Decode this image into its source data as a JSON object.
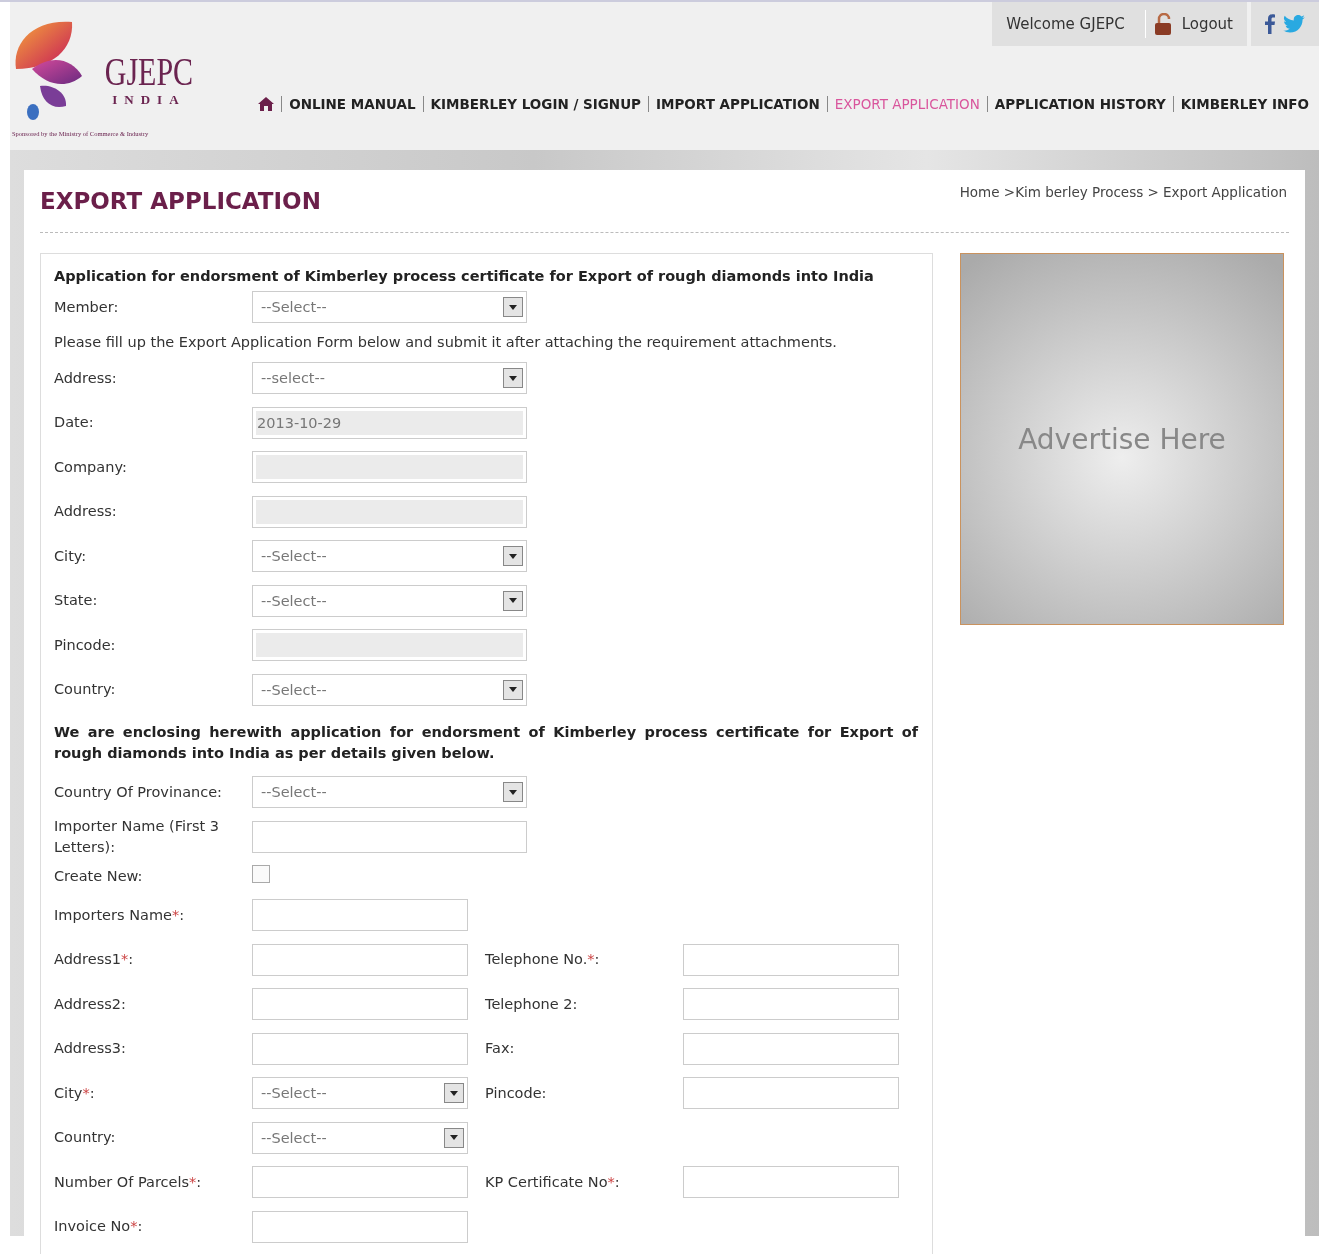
{
  "logo": {
    "name": "GJEPC",
    "country": "INDIA",
    "tagline": "Sponsored by the Ministry of Commerce & Industry"
  },
  "top_bar": {
    "welcome": "Welcome GJEPC",
    "logout": "Logout"
  },
  "nav": [
    {
      "label": "ONLINE MANUAL",
      "selected": false
    },
    {
      "label": "KIMBERLEY LOGIN / SIGNUP",
      "selected": false
    },
    {
      "label": "IMPORT APPLICATION",
      "selected": false
    },
    {
      "label": "EXPORT APPLICATION",
      "selected": true
    },
    {
      "label": "APPLICATION HISTORY",
      "selected": false
    },
    {
      "label": "KIMBERLEY INFO",
      "selected": false
    }
  ],
  "page_title": "EXPORT APPLICATION",
  "breadcrumb": "Home >Kim berley Process > Export Application",
  "form": {
    "heading": "Application for endorsment of Kimberley process certificate for Export of rough diamonds into India",
    "member": {
      "label": "Member:",
      "kind": "select",
      "value": "--Select--"
    },
    "instruction": "Please fill up the Export Application Form below and submit it after attaching the requirement attachments.",
    "fields": [
      {
        "label": "Address:",
        "kind": "select",
        "value": "--select--"
      },
      {
        "label": "Date:",
        "kind": "disabled",
        "value": "2013-10-29"
      },
      {
        "label": "Company:",
        "kind": "disabled"
      },
      {
        "label": "Address:",
        "kind": "disabled"
      },
      {
        "label": "City:",
        "kind": "select",
        "value": "--Select--"
      },
      {
        "label": "State:",
        "kind": "select",
        "value": "--Select--"
      },
      {
        "label": "Pincode:",
        "kind": "disabled"
      },
      {
        "label": "Country:",
        "kind": "select",
        "value": "--Select--"
      }
    ],
    "enclosing_note": "We are enclosing herewith application for endorsment of Kimberley process certificate for Export of rough diamonds into India as per details given below.",
    "importer_fields": [
      {
        "label": "Country Of Provinance:",
        "kind": "select",
        "value": "--Select--"
      },
      {
        "label": "Importer Name (First 3 Letters):",
        "kind": "text"
      },
      {
        "label": "Create New:",
        "kind": "checkbox",
        "checked": false
      }
    ],
    "detail_rows": [
      {
        "left": {
          "label": "Importers Name",
          "required_mark": "*",
          "label_end": ":",
          "kind": "text"
        }
      },
      {
        "left": {
          "label": "Address1",
          "required_mark": "*",
          "label_end": ":",
          "kind": "text"
        },
        "right": {
          "label": "Telephone No.",
          "required_mark": "*",
          "label_end": ":",
          "kind": "text"
        }
      },
      {
        "left": {
          "label": "Address2:",
          "kind": "text"
        },
        "right": {
          "label": "Telephone 2:",
          "kind": "text"
        }
      },
      {
        "left": {
          "label": "Address3:",
          "kind": "text"
        },
        "right": {
          "label": "Fax:",
          "kind": "text"
        }
      },
      {
        "left": {
          "label": "City",
          "required_mark": "*",
          "label_end": ":",
          "kind": "select",
          "value": "--Select--"
        },
        "right": {
          "label": "Pincode:",
          "kind": "text"
        }
      },
      {
        "left": {
          "label": "Country:",
          "kind": "select",
          "value": "--Select--"
        }
      },
      {
        "left": {
          "label": "Number Of Parcels",
          "required_mark": "*",
          "label_end": ":",
          "kind": "text"
        },
        "right": {
          "label": "KP Certificate No",
          "required_mark": "*",
          "label_end": ":",
          "kind": "text"
        }
      },
      {
        "left": {
          "label": "Invoice No",
          "required_mark": "*",
          "label_end": ":",
          "kind": "text"
        }
      }
    ]
  },
  "ad": {
    "text": "Advertise Here"
  }
}
